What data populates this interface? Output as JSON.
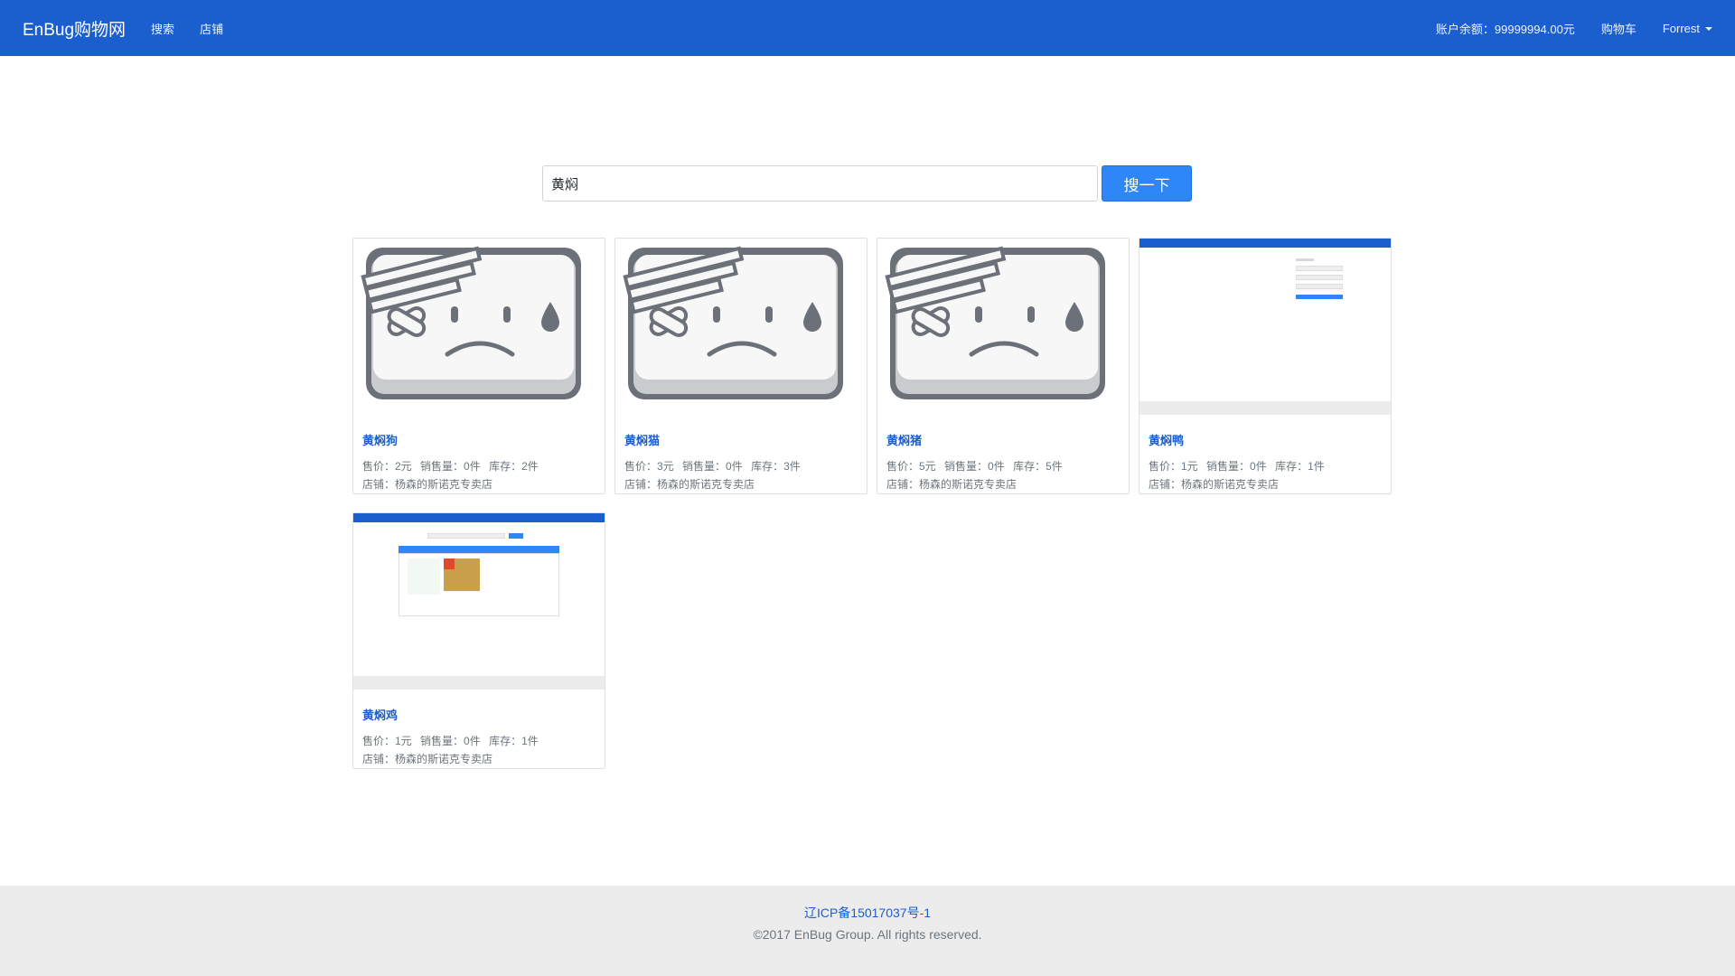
{
  "navbar": {
    "brand": "EnBug购物网",
    "links": [
      "搜索",
      "店铺"
    ],
    "balance": "账户余额：99999994.00元",
    "cart": "购物车",
    "user": "Forrest"
  },
  "search": {
    "value": "黄焖",
    "button": "搜一下"
  },
  "products": [
    {
      "name": "黄焖狗",
      "price": "售价：2元",
      "sales": "销售量：0件",
      "stock": "库存：2件",
      "shop": "店铺：杨森的斯诺克专卖店",
      "image": "broken-image-icon"
    },
    {
      "name": "黄焖猫",
      "price": "售价：3元",
      "sales": "销售量：0件",
      "stock": "库存：3件",
      "shop": "店铺：杨森的斯诺克专卖店",
      "image": "broken-image-icon"
    },
    {
      "name": "黄焖猪",
      "price": "售价：5元",
      "sales": "销售量：0件",
      "stock": "库存：5件",
      "shop": "店铺：杨森的斯诺克专卖店",
      "image": "broken-image-icon"
    },
    {
      "name": "黄焖鸭",
      "price": "售价：1元",
      "sales": "销售量：0件",
      "stock": "库存：1件",
      "shop": "店铺：杨森的斯诺克专卖店",
      "image": "login-page-screenshot"
    },
    {
      "name": "黄焖鸡",
      "price": "售价：1元",
      "sales": "销售量：0件",
      "stock": "库存：1件",
      "shop": "店铺：杨森的斯诺克专卖店",
      "image": "search-page-screenshot"
    }
  ],
  "footer": {
    "icp": "辽ICP备15017037号-1",
    "copyright": "©2017 EnBug Group. All rights reserved."
  },
  "colors": {
    "navbar": "#1b5fcf",
    "button": "#2f86f6",
    "link": "#1b5fcf",
    "footer_bg": "#ececec"
  }
}
